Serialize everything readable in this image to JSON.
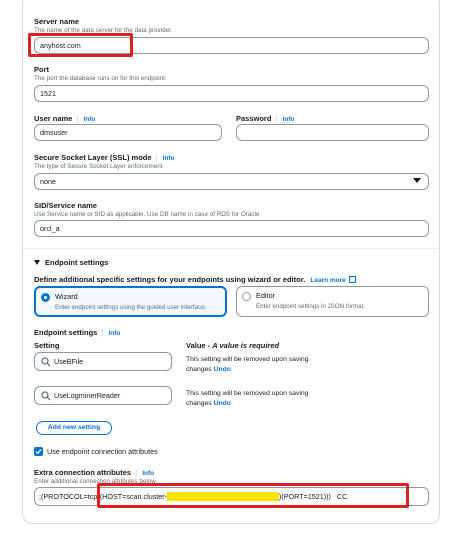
{
  "server": {
    "label": "Server name",
    "description": "The name of the data server for the data provider.",
    "value": "anyhost.com"
  },
  "port": {
    "label": "Port",
    "description": "The port the database runs on for this endpoint.",
    "value": "1521"
  },
  "username": {
    "label": "User name",
    "info": "Info",
    "value": "dmsuser"
  },
  "password": {
    "label": "Password",
    "info": "Info",
    "value": ""
  },
  "ssl": {
    "label": "Secure Socket Layer (SSL) mode",
    "info": "Info",
    "description": "The type of Secure Socket Layer enforcement",
    "value": "none"
  },
  "sid": {
    "label": "SID/Service name",
    "description": "Use Service name or SID as applicable. Use DB name in case of RDS for Oracle",
    "value": "orcl_a"
  },
  "endpoint_settings_section": {
    "title": "Endpoint settings",
    "define_text": "Define additional specific settings for your endpoints using wizard or editor.",
    "learn_more": "Learn more",
    "wizard": {
      "title": "Wizard",
      "description": "Enter endpoint settings using the guided user interface.",
      "selected": true
    },
    "editor": {
      "title": "Editor",
      "description": "Enter endpoint settings in JSON format.",
      "selected": false
    },
    "settings_label": "Endpoint settings",
    "settings_info": "Info",
    "col_setting": "Setting",
    "col_value": "Value - ",
    "col_value_em": "A value is required",
    "rows": [
      {
        "setting": "UseBFile",
        "note_line1": "This setting will be removed upon saving",
        "note_line2": "changes ",
        "undo": "Undo"
      },
      {
        "setting": "UseLogminerReader",
        "note_line1": "This setting will be removed upon saving",
        "note_line2": "changes ",
        "undo": "Undo"
      }
    ],
    "add_button": "Add new setting",
    "use_attributes_label": "Use endpoint connection attributes",
    "use_attributes_checked": true
  },
  "extra_attributes": {
    "label": "Extra connection attributes",
    "info": "Info",
    "description": "Enter additional connection attributes below",
    "value_prefix": ";(PROTOCOL=tcp)(HOST=scan.cluster-",
    "value_suffix": ")(PORT=1521)))",
    "value_tail": "CC"
  },
  "colors": {
    "accent": "#0972d3",
    "annotation_red": "#e02020",
    "redaction_yellow": "#f5e400"
  }
}
